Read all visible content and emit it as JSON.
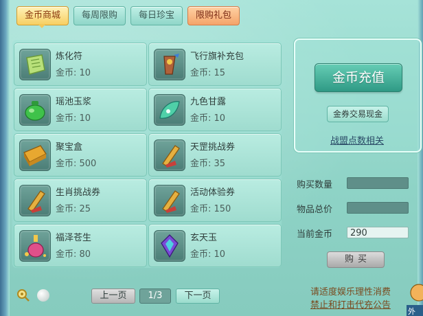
{
  "tabs": [
    {
      "label": "金币商城",
      "state": "active"
    },
    {
      "label": "每周限购",
      "state": "normal"
    },
    {
      "label": "每日珍宝",
      "state": "normal"
    },
    {
      "label": "限购礼包",
      "state": "hot"
    }
  ],
  "items": [
    {
      "name": "炼化符",
      "price": "金币: 10",
      "icon": "talisman-icon"
    },
    {
      "name": "飞行旗补充包",
      "price": "金币: 15",
      "icon": "flag-pack-icon"
    },
    {
      "name": "瑶池玉浆",
      "price": "金币: 10",
      "icon": "jade-pot-icon"
    },
    {
      "name": "九色甘露",
      "price": "金币: 10",
      "icon": "dew-leaf-icon"
    },
    {
      "name": "聚宝盒",
      "price": "金币: 500",
      "icon": "treasure-box-icon"
    },
    {
      "name": "天罡挑战券",
      "price": "金币: 35",
      "icon": "scroll-icon"
    },
    {
      "name": "生肖挑战券",
      "price": "金币: 25",
      "icon": "scroll-icon"
    },
    {
      "name": "活动体验券",
      "price": "金币: 150",
      "icon": "scroll-icon"
    },
    {
      "name": "福泽苍生",
      "price": "金币: 80",
      "icon": "potion-bottle-icon"
    },
    {
      "name": "玄天玉",
      "price": "金币: 10",
      "icon": "gem-icon"
    }
  ],
  "recharge": {
    "main_button": "金币充值",
    "exchange_button": "金券交易现金",
    "link": "战盟点数相关"
  },
  "form": {
    "quantity_label": "购买数量",
    "quantity_value": "",
    "total_label": "物品总价",
    "total_value": "",
    "balance_label": "当前金币",
    "balance_value": "290",
    "buy_button": "购买"
  },
  "pager": {
    "prev": "上一页",
    "indicator": "1/3",
    "next": "下一页"
  },
  "notices": {
    "line1": "请适度娱乐理性消费",
    "line2": "禁止和打击代充公告"
  },
  "corner_text": "外"
}
